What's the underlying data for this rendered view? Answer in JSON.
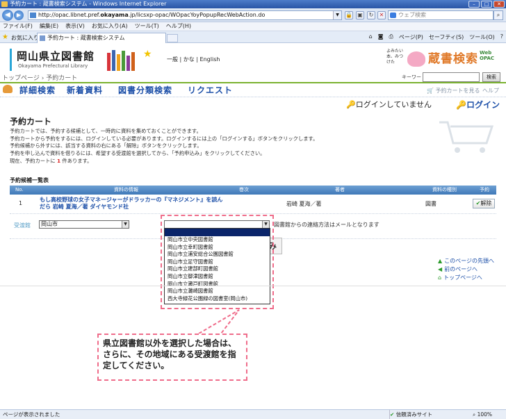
{
  "browser": {
    "title": "予約カート : 蔵書検索システム - Windows Internet Explorer",
    "url_prefix": "http://opac.libnet.pref.",
    "url_host": "okayama",
    "url_rest": ".jp/licsxp-opac/WOpacYoyPopupRecWebAction.do",
    "search_placeholder": "ウェブ検索",
    "menu": [
      "ファイル(F)",
      "編集(E)",
      "表示(V)",
      "お気に入り(A)",
      "ツール(T)",
      "ヘルプ(H)"
    ],
    "favorites_label": "お気に入り",
    "tab_title": "予約カート : 蔵書検索システム",
    "commands": [
      "ページ(P)",
      "セーフティ(S)",
      "ツール(O)"
    ],
    "status_text": "ページが表示されました",
    "security": "信頼済みサイト",
    "zoom": "100%"
  },
  "site": {
    "logo_jp": "岡山県立図書館",
    "logo_en": "Okayama Prefectural Library",
    "lang_links": "一般 | かな | English",
    "opac_small": "よみたい本、みつけた",
    "opac_big": "蔵書検索",
    "opac_web": "Web",
    "opac_opac": "OPAC",
    "breadcrumb_top": "トップページ",
    "breadcrumb_sep": "›",
    "breadcrumb_current": "予約カート",
    "keyword_label": "キーワード",
    "search_button": "検索",
    "nav": [
      "詳細検索",
      "新着資料",
      "図書分類検索",
      "リクエスト"
    ],
    "cart_view": "予約カートを見る",
    "help": "ヘルプ",
    "login_status": "ログインしていません",
    "login_button": "ログイン"
  },
  "main": {
    "heading": "予約カート",
    "desc": [
      "予約カートでは、予約する候補として、一時的に資料を集めておくことができます。",
      "予約カートから予約をするには、ログインしている必要があります。ログインするには上の「ログインする」ボタンをクリックします。",
      "予約候補から外すには、該当する資料の右にある「解除」ボタンをクリックします。",
      "予約を申し込んで資料を借りるには、希望する受渡館を選択してから、「予約申込み」をクリックしてください。"
    ],
    "count_prefix": "現在、予約カートに",
    "count": "1",
    "count_suffix": "件あります。",
    "list_heading": "予約候補一覧表",
    "columns": [
      "No.",
      "資料の情報",
      "巻次",
      "著者",
      "資料の種別",
      "予約"
    ],
    "rows": [
      {
        "no": "1",
        "title_line1": "もし高校野球の女子マネージャーがドラッカーの『マネジメント』を読ん",
        "title_line2": "だら 岩崎 夏海／著 ダイヤモンド社",
        "author": "岩崎 夏海／著",
        "kind": "図書",
        "action": "解除"
      }
    ],
    "receive_label": "受渡館",
    "receive_selected": "岡山市",
    "mail_text": "図書館からの連絡方法はメールとなります",
    "hidden_btn": "み",
    "dropdown_options": [
      "岡山市立中央図書館",
      "岡山市立幸町図書館",
      "岡山市立浦安総合公園図書館",
      "岡山市立足守図書館",
      "岡山市立建部町図書館",
      "岡山市立御津図書館",
      "岡山市立瀬戸町図書館",
      "岡山市立灘崎図書館",
      "西大寺緑花公園緑の図書室(岡山市)"
    ],
    "side_links": [
      "このページの先頭へ",
      "前のページへ",
      "トップページへ"
    ],
    "callout": "県立図書館以外を選択した場合は、さらに、その地域にある受渡館を指定してください。"
  }
}
